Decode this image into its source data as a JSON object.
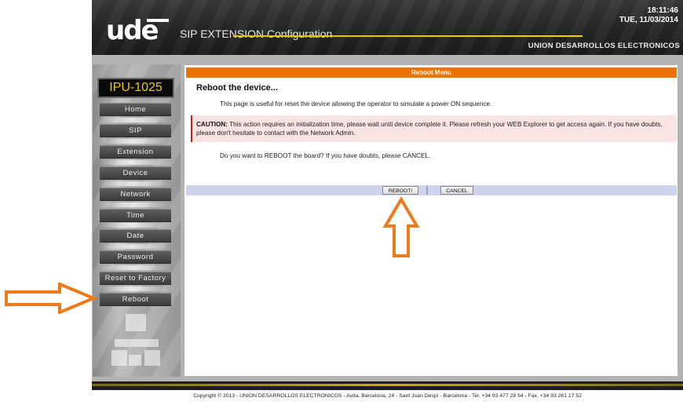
{
  "header": {
    "logo": "ude",
    "app_title": "SIP EXTENSION Configuration",
    "time": "18:11:46",
    "date": "TUE, 11/03/2014",
    "company": "UNION DESARROLLOS ELECTRONICOS"
  },
  "sidebar": {
    "device_name": "IPU-1025",
    "items": [
      {
        "label": "Home"
      },
      {
        "label": "SIP"
      },
      {
        "label": "Extension"
      },
      {
        "label": "Device"
      },
      {
        "label": "Network"
      },
      {
        "label": "Time"
      },
      {
        "label": "Date"
      },
      {
        "label": "Password"
      },
      {
        "label": "Reset to Factory"
      },
      {
        "label": "Reboot"
      }
    ]
  },
  "main": {
    "menu_title": "Reboot Menu",
    "heading": "Reboot the device...",
    "description": "This page is useful for reset the device allowing the operator to simulate a power ON sequence.",
    "caution_label": "CAUTION:",
    "caution_text": " This action requires an initialization time, please wait until device complete it. Please refresh your WEB Explorer to get access again. If you have doubts, please don't hesitate to contact with the Network Admin.",
    "question": "Do you want to REBOOT the board? If you have doubts, please CANCEL.",
    "reboot_label": "REBOOT!",
    "cancel_label": "CANCEL"
  },
  "footer": {
    "copyright": "Copyright  © 2013 - UNION DESARROLLOS ELECTRONICOS  -  Avda. Barcelona, 24 - Sant Joan Despí  -  Barcelona  -  Tel. +34 93 477 28 54  -  Fax. +34 93 261 17 52"
  },
  "colors": {
    "accent": "#ee7200",
    "header_bg": "#262626",
    "device_text": "#f0c800",
    "button_bar": "#cfd3ee",
    "caution_bg": "#f9e3e3"
  }
}
